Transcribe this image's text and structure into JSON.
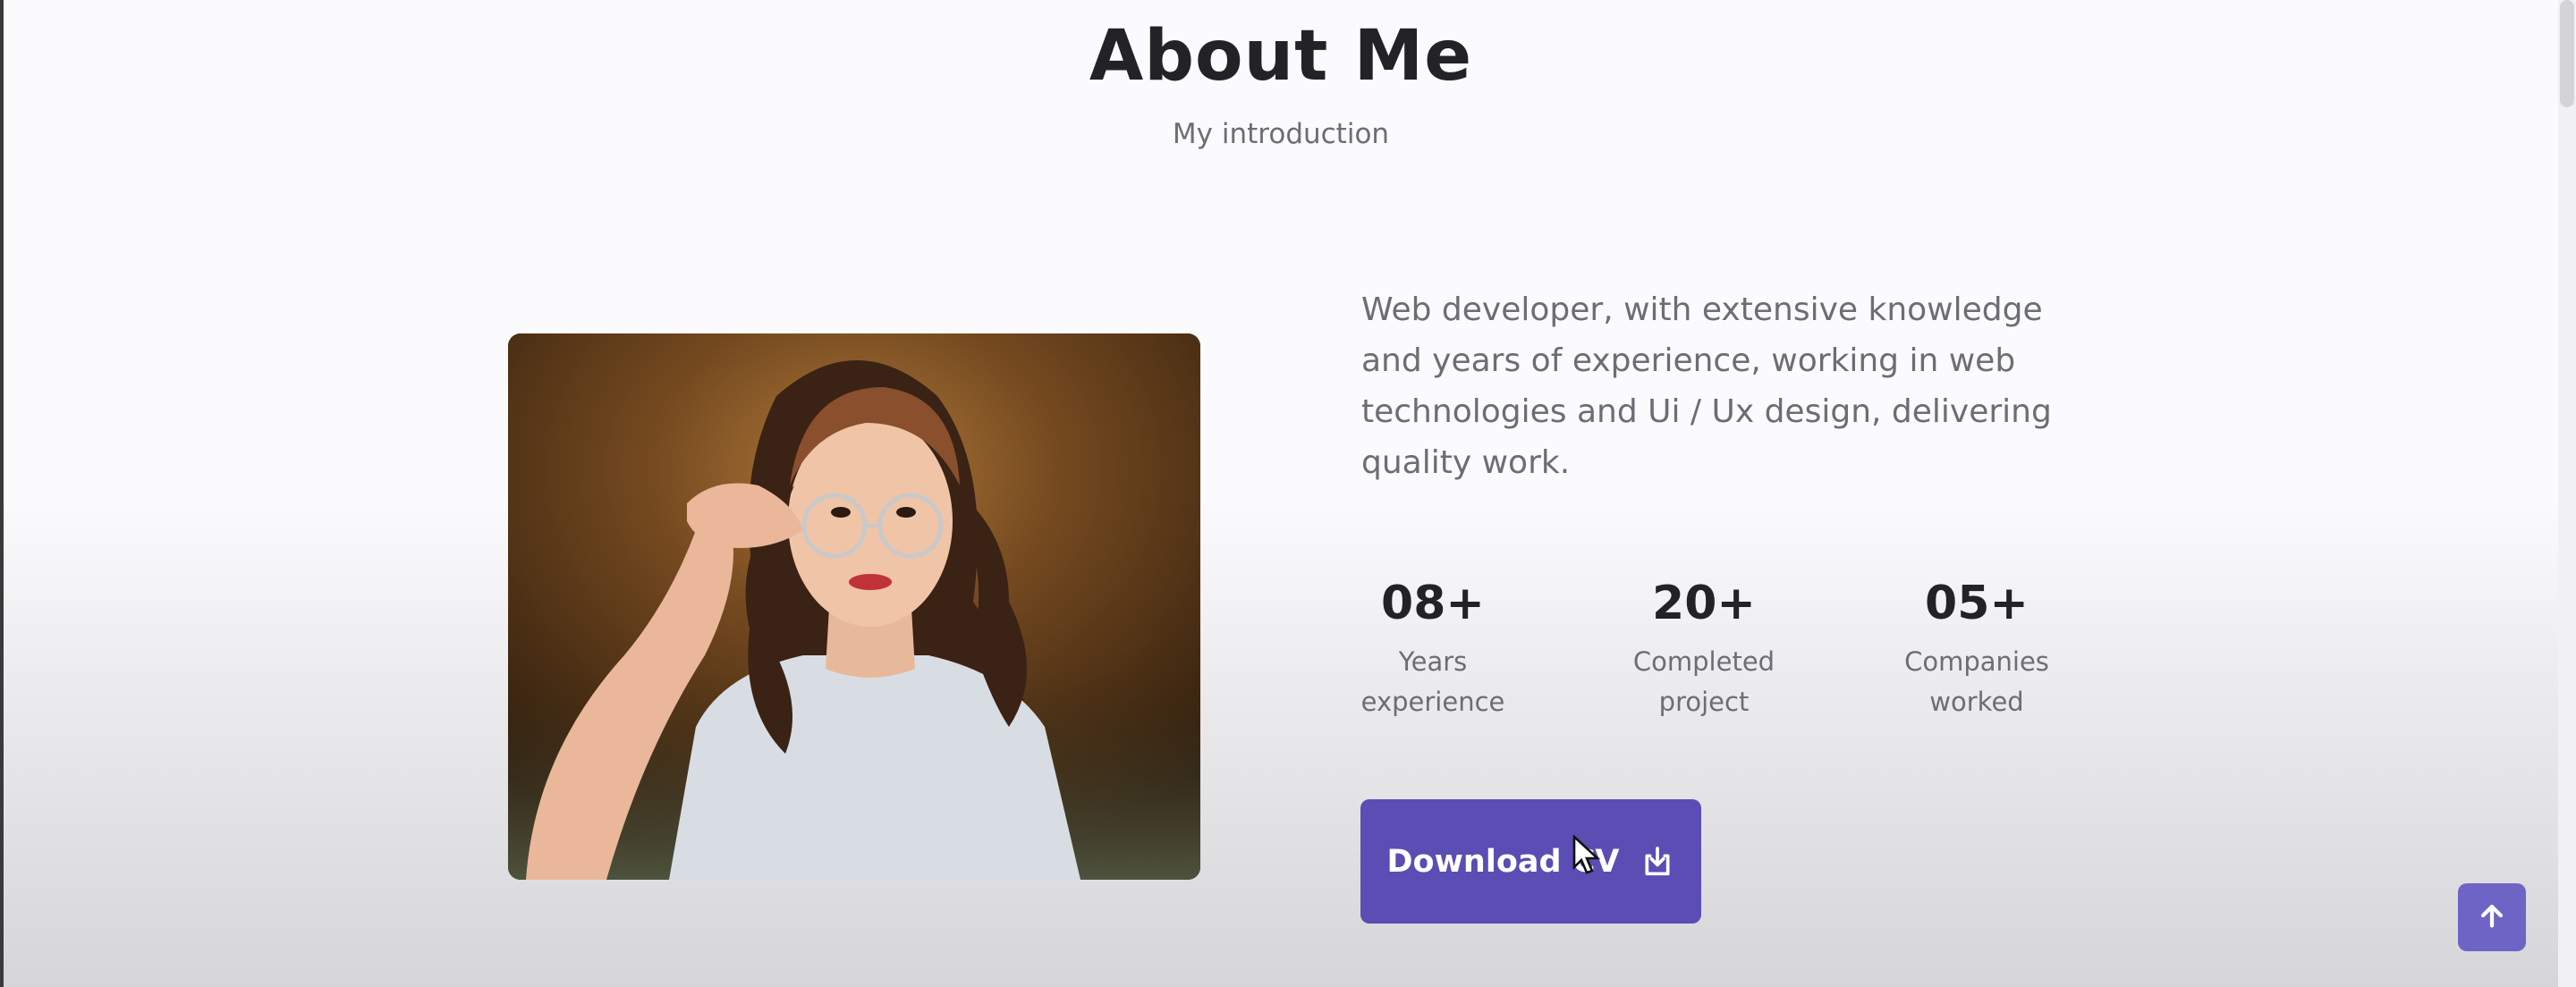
{
  "section": {
    "title": "About Me",
    "subtitle": "My introduction"
  },
  "about": {
    "description": "Web developer, with extensive knowledge and years of experience, working in web technologies and Ui / Ux design, delivering quality work.",
    "stats": [
      {
        "number": "08+",
        "label_line1": "Years",
        "label_line2": "experience"
      },
      {
        "number": "20+",
        "label_line1": "Completed",
        "label_line2": "project"
      },
      {
        "number": "05+",
        "label_line1": "Companies",
        "label_line2": "worked"
      }
    ],
    "download_button": {
      "label": "Download CV",
      "icon": "download-icon"
    }
  },
  "scroll_top": {
    "icon": "arrow-up-icon"
  },
  "colors": {
    "accent": "#5a4db4",
    "scroll_top": "#6e64c6",
    "title": "#232227",
    "text": "#6e6c74"
  }
}
